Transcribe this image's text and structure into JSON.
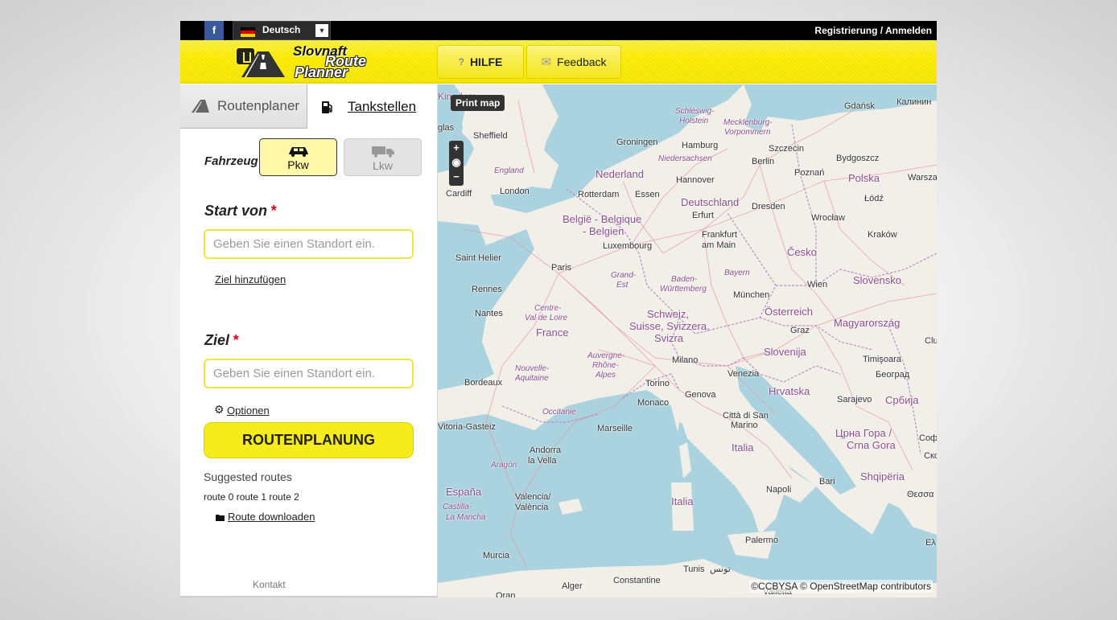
{
  "topbar": {
    "facebook_label": "f",
    "language": "Deutsch",
    "language_flag_colors": [
      "#000000",
      "#dd0000",
      "#ffce00"
    ],
    "auth_link": "Registrierung / Anmelden"
  },
  "header": {
    "logo": {
      "line1": "Slovnaft",
      "line2": "Route",
      "line3": "Planner"
    },
    "help_label": "HILFE",
    "help_icon": "?",
    "feedback_label": "Feedback",
    "feedback_icon": "✉"
  },
  "tabs": {
    "route": {
      "label": "Routenplaner",
      "icon": "route-icon"
    },
    "tank": {
      "label": "Tankstellen",
      "icon": "fuel-pump-icon"
    }
  },
  "form": {
    "vehicle_label": "Fahrzeug",
    "vehicles": [
      {
        "label": "Pkw",
        "icon": "car-icon",
        "selected": true
      },
      {
        "label": "Lkw",
        "icon": "truck-icon",
        "selected": false
      }
    ],
    "start_label": "Start von",
    "start_placeholder": "Geben Sie einen Standort ein.",
    "add_destination_link": "Ziel hinzufügen",
    "dest_label": "Ziel",
    "dest_placeholder": "Geben Sie einen Standort ein.",
    "required_mark": "*",
    "options_link": "Optionen",
    "plan_button": "ROUTENPLANUNG",
    "suggested_title": "Suggested routes",
    "routes_text": "route 0 route 1 route 2",
    "download_link": "Route downloaden",
    "contact_link": "Kontakt"
  },
  "map": {
    "print_button": "Print map",
    "zoom_in": "+",
    "zoom_globe": "◉",
    "zoom_out": "−",
    "attribution": "©CCBYSA © OpenStreetMap contributors",
    "colors": {
      "water": "#aad3df",
      "land": "#f2efe9",
      "roads": "#e8919a",
      "borders": "#b98bc1"
    },
    "labels": [
      "Kingdom",
      "glas",
      "Sheffield",
      "England",
      "Cardiff",
      "London",
      "Groningen",
      "Hamburg",
      "Schleswig-",
      "Holstein",
      "Mecklenburg-",
      "Vorpommern",
      "Niedersachsen",
      "Nederland",
      "Rotterdam",
      "Essen",
      "Hannover",
      "Berlin",
      "Szczecin",
      "Gdańsk",
      "Калинин",
      "Bydgoszcz",
      "Poznań",
      "Polska",
      "Warsza",
      "Łódź",
      "Deutschland",
      "Dresden",
      "Wrocław",
      "Erfurt",
      "België - Belgique",
      "- Belgien",
      "Frankfurt",
      "am Main",
      "Luxembourg",
      "Kraków",
      "Česko",
      "Saint Helier",
      "Paris",
      "Grand-",
      "Est",
      "Baden-",
      "Württemberg",
      "Bayern",
      "Wien",
      "Slovensko",
      "Rennes",
      "Nantes",
      "München",
      "Centre-",
      "Val de Loire",
      "France",
      "Schweiz,",
      "Suisse, Svizzera,",
      "Svizra",
      "Österreich",
      "Magyarország",
      "Graz",
      "Slovenija",
      "Clu",
      "Auvergne-",
      "Rhône-",
      "Alpes",
      "Nouvelle-",
      "Aquitaine",
      "Bordeaux",
      "Milano",
      "Timişoara",
      "Torino",
      "Venezia",
      "Београд",
      "Hrvatska",
      "Monaco",
      "Genova",
      "Sarajevo",
      "Србија",
      "Occitanie",
      "Marseille",
      "Città di San",
      "Marino",
      "Vitoria-Gasteiz",
      "Andorra",
      "la Vella",
      "Црна Гора /",
      "Crna Gora",
      "Софи",
      "Italia",
      "Скоп",
      "Aragón",
      "España",
      "Castilla-",
      "La Mancha",
      "Valencia/",
      "València",
      "Napoli",
      "Bari",
      "Shqipëria",
      "Θεσσα",
      "Italia",
      "Murcia",
      "Palermo",
      "Tunis",
      "تونس",
      "Constantine",
      "Alger",
      "Oran",
      "Valletta",
      "Ελ"
    ]
  }
}
